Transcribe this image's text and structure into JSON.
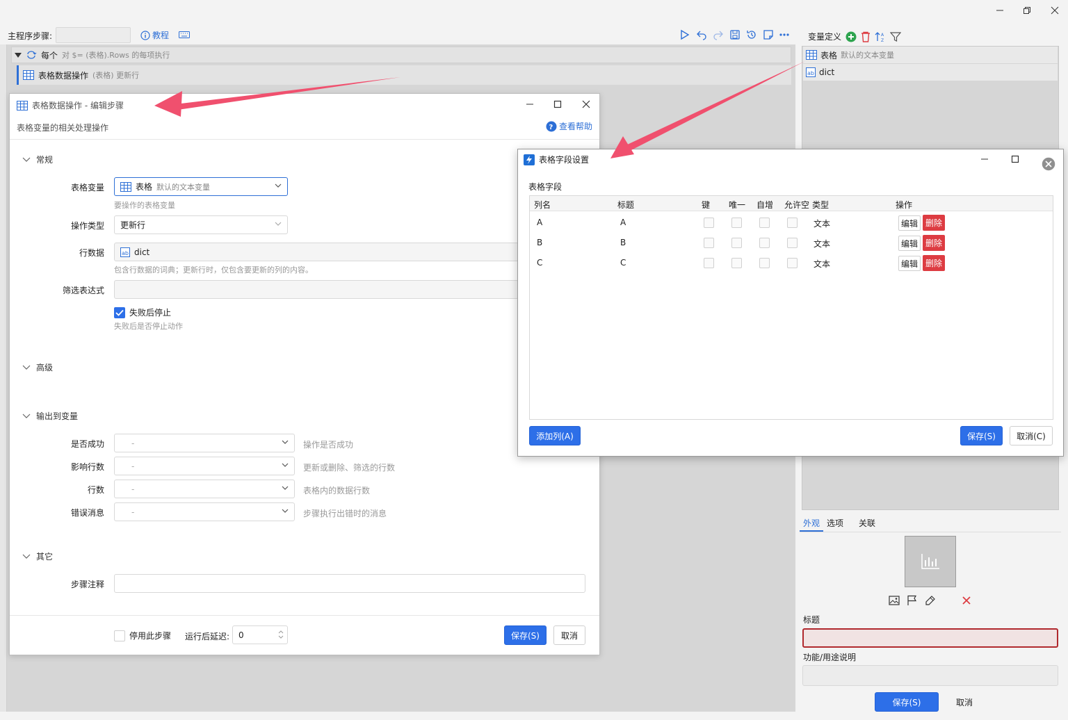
{
  "main": {
    "step_label": "主程序步骤:",
    "tutorial_label": "教程",
    "loop_row": {
      "label": "每个",
      "desc": "对 $= (表格).Rows 的每项执行"
    },
    "step_row": {
      "label": "表格数据操作",
      "desc": "(表格) 更新行"
    }
  },
  "right_panel": {
    "header": "变量定义",
    "variables": [
      {
        "name": "表格",
        "desc": "默认的文本变量"
      },
      {
        "name": "dict",
        "desc": ""
      }
    ],
    "tabs": [
      "外观",
      "选项",
      "关联"
    ],
    "title_label": "标题",
    "desc_label": "功能/用途说明",
    "save_label": "保存(S)",
    "cancel_label": "取消"
  },
  "edit_dialog": {
    "title": "表格数据操作  -  编辑步骤",
    "subtitle": "表格变量的相关处理操作",
    "help_label": "查看帮助",
    "sections": {
      "general": "常规",
      "advanced": "高级",
      "output": "输出到变量",
      "other": "其它"
    },
    "table_var": {
      "label": "表格变量",
      "value": "表格",
      "value_desc": "默认的文本变量",
      "hint": "要操作的表格变量"
    },
    "op_type": {
      "label": "操作类型",
      "value": "更新行"
    },
    "row_data": {
      "label": "行数据",
      "value": "dict",
      "hint": "包含行数据的词典；更新行时，仅包含要更新的列的内容。"
    },
    "filter": {
      "label": "筛选表达式",
      "value": ""
    },
    "stop_on_fail": {
      "label": "失败后停止",
      "hint": "失败后是否停止动作",
      "checked": true
    },
    "outputs": [
      {
        "label": "是否成功",
        "value": "-",
        "hint": "操作是否成功"
      },
      {
        "label": "影响行数",
        "value": "-",
        "hint": "更新或删除、筛选的行数"
      },
      {
        "label": "行数",
        "value": "-",
        "hint": "表格内的数据行数"
      },
      {
        "label": "错误消息",
        "value": "-",
        "hint": "步骤执行出错时的消息"
      }
    ],
    "note_label": "步骤注释",
    "disable_label": "停用此步骤",
    "delay_label": "运行后延迟:",
    "delay_value": "0",
    "save_label": "保存(S)",
    "cancel_label": "取消"
  },
  "field_dialog": {
    "title": "表格字段设置",
    "group_label": "表格字段",
    "columns": [
      "列名",
      "标题",
      "键",
      "唯一",
      "自增",
      "允许空",
      "类型",
      "操作"
    ],
    "rows": [
      {
        "name": "A",
        "title": "A",
        "type": "文本"
      },
      {
        "name": "B",
        "title": "B",
        "type": "文本"
      },
      {
        "name": "C",
        "title": "C",
        "type": "文本"
      }
    ],
    "edit_label": "编辑",
    "delete_label": "删除",
    "add_label": "添加列(A)",
    "save_label": "保存(S)",
    "cancel_label": "取消(C)"
  },
  "colors": {
    "accent": "#2d6fe8",
    "danger": "#dd3c42",
    "arrow": "#f0506e"
  }
}
